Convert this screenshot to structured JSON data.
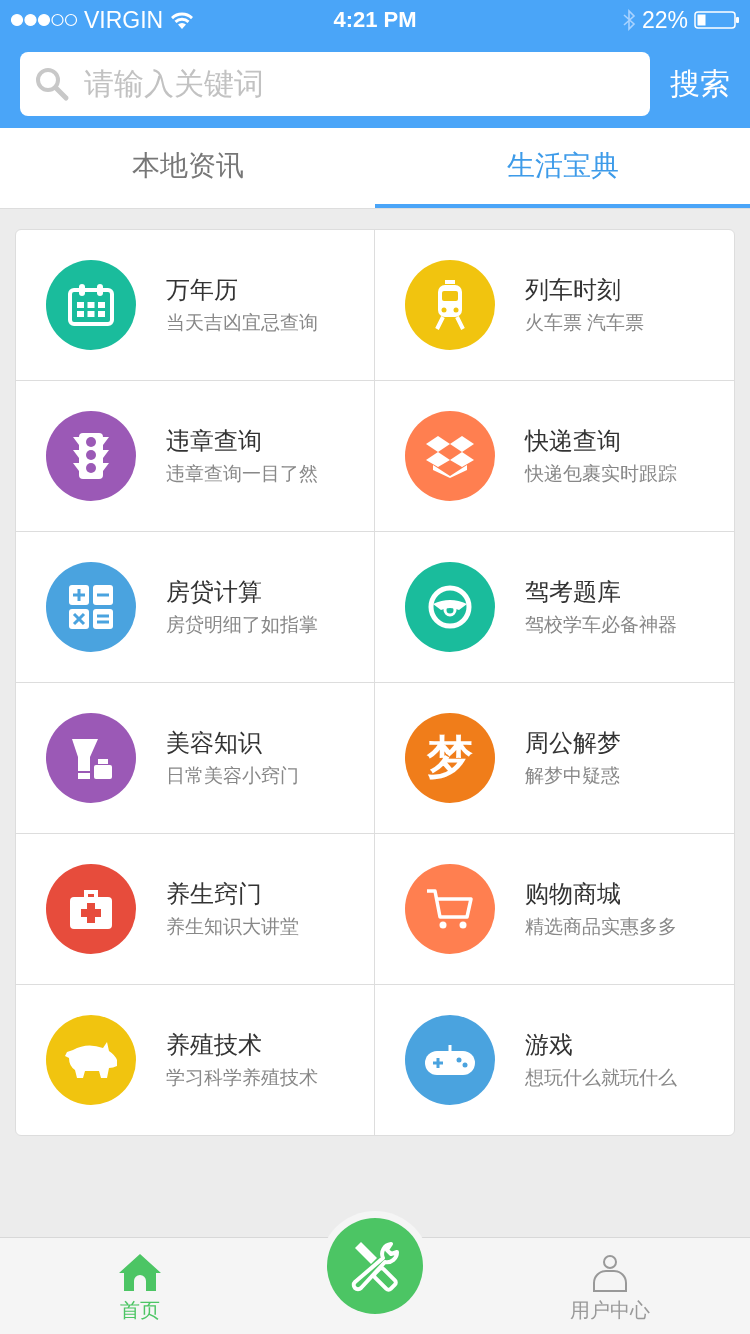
{
  "status_bar": {
    "carrier": "VIRGIN",
    "time": "4:21 PM",
    "battery": "22%"
  },
  "search": {
    "placeholder": "请输入关键词",
    "button": "搜索"
  },
  "tabs": [
    {
      "label": "本地资讯",
      "selected": false
    },
    {
      "label": "生活宝典",
      "selected": true
    }
  ],
  "services": [
    {
      "kind": "calendar",
      "color": "#1abc9c",
      "title": "万年历",
      "subtitle": "当天吉凶宜忌查询"
    },
    {
      "kind": "train",
      "color": "#f1c40f",
      "title": "列车时刻",
      "subtitle": "火车票 汽车票"
    },
    {
      "kind": "traffic",
      "color": "#9b59b6",
      "title": "违章查询",
      "subtitle": "违章查询一目了然"
    },
    {
      "kind": "box",
      "color": "#ff7f50",
      "title": "快递查询",
      "subtitle": "快递包裹实时跟踪"
    },
    {
      "kind": "calculator",
      "color": "#4aa3df",
      "title": "房贷计算",
      "subtitle": "房贷明细了如指掌"
    },
    {
      "kind": "wheel",
      "color": "#1abc9c",
      "title": "驾考题库",
      "subtitle": "驾校学车必备神器"
    },
    {
      "kind": "cosmetics",
      "color": "#9b59b6",
      "title": "美容知识",
      "subtitle": "日常美容小窍门"
    },
    {
      "kind": "glyph",
      "glyph": "梦",
      "color": "#f07d1a",
      "title": "周公解梦",
      "subtitle": "解梦中疑惑"
    },
    {
      "kind": "medkit",
      "color": "#e74c3c",
      "title": "养生窍门",
      "subtitle": "养生知识大讲堂"
    },
    {
      "kind": "cart",
      "color": "#ff7f50",
      "title": "购物商城",
      "subtitle": "精选商品实惠多多"
    },
    {
      "kind": "pig",
      "color": "#f1c40f",
      "title": "养殖技术",
      "subtitle": "学习科学养殖技术"
    },
    {
      "kind": "gamepad",
      "color": "#4aa3df",
      "title": "游戏",
      "subtitle": "想玩什么就玩什么"
    }
  ],
  "bottom_nav": [
    {
      "kind": "home",
      "label": "首页",
      "selected": true
    },
    {
      "kind": "tools",
      "selected": false
    },
    {
      "kind": "user",
      "label": "用户中心",
      "selected": false
    }
  ]
}
